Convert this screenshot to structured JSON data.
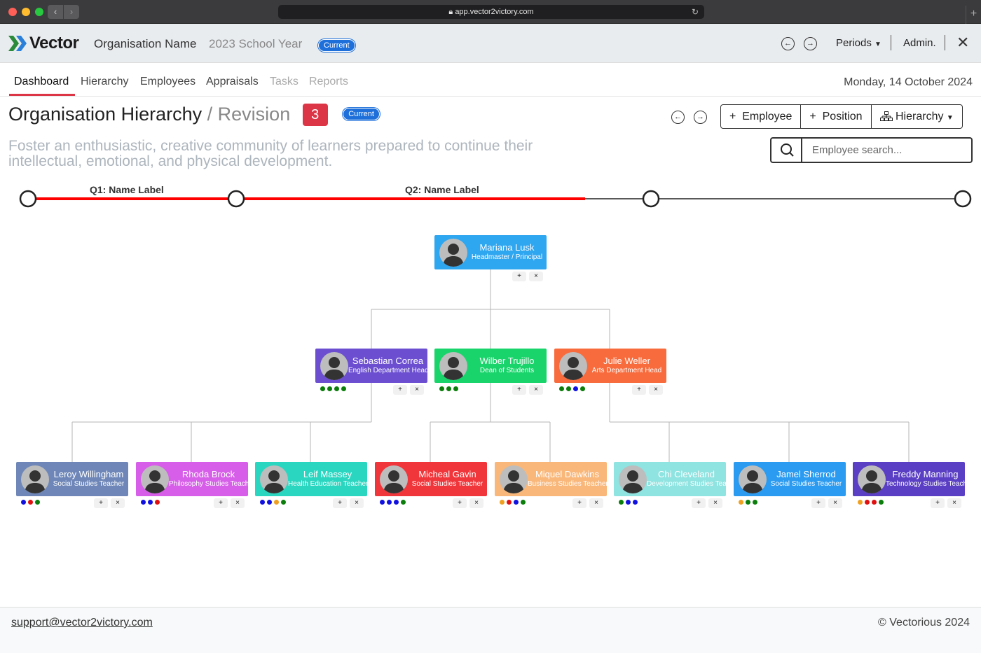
{
  "browser": {
    "url": "app.vector2victory.com",
    "back": "‹",
    "forward": "›"
  },
  "header": {
    "brand": "Vector",
    "org_name": "Organisation Name",
    "year": "2023 School Year",
    "year_badge": "Current",
    "periods_label": "Periods",
    "admin_label": "Admin."
  },
  "tabs": [
    {
      "label": "Dashboard",
      "state": "active"
    },
    {
      "label": "Hierarchy",
      "state": "normal"
    },
    {
      "label": "Employees",
      "state": "normal"
    },
    {
      "label": "Appraisals",
      "state": "normal"
    },
    {
      "label": "Tasks",
      "state": "disabled"
    },
    {
      "label": "Reports",
      "state": "disabled"
    }
  ],
  "date": "Monday, 14 October 2024",
  "page": {
    "title": "Organisation Hierarchy",
    "subtitle": "Revision",
    "revision": "3",
    "badge": "Current",
    "mission": "Foster an enthusiastic, creative community of learners prepared to continue their intellectual, emotional, and physical development."
  },
  "actions": {
    "employee": "Employee",
    "position": "Position",
    "hierarchy": "Hierarchy"
  },
  "search": {
    "placeholder": "Employee search..."
  },
  "timeline": {
    "labels": [
      "Q1: Name Label",
      "Q2: Name Label"
    ],
    "active_color": "#ff0000"
  },
  "orgchart": {
    "root": {
      "name": "Mariana Lusk",
      "role": "Headmaster / Principal",
      "color": "#2fa6f0",
      "dots": []
    },
    "level1": [
      {
        "name": "Sebastian Correa",
        "role": "English Department Head",
        "color": "#6c4fd1",
        "dots": [
          "#0a7d0a",
          "#0a7d0a",
          "#0a7d0a",
          "#0a7d0a"
        ]
      },
      {
        "name": "Wilber Trujillo",
        "role": "Dean of Students",
        "color": "#18d46a",
        "dots": [
          "#0a7d0a",
          "#0a7d0a",
          "#0a7d0a"
        ]
      },
      {
        "name": "Julie Weller",
        "role": "Arts Department Head",
        "color": "#f76b3c",
        "dots": [
          "#0a7d0a",
          "#0a7d0a",
          "#1010e0",
          "#0a7d0a"
        ]
      }
    ],
    "level2": [
      {
        "name": "Leroy Willingham",
        "role": "Social Studies Teacher",
        "color": "#6e87b8",
        "dots": [
          "#1010e0",
          "#e01010",
          "#0a7d0a"
        ]
      },
      {
        "name": "Rhoda Brock",
        "role": "Philosophy Studies Teacher",
        "color": "#d65ee8",
        "dots": [
          "#1010e0",
          "#1010e0",
          "#e01010"
        ]
      },
      {
        "name": "Leif Massey",
        "role": "Health Education Teacher",
        "color": "#2ad6c0",
        "dots": [
          "#1010e0",
          "#1010e0",
          "#f0a020",
          "#0a7d0a"
        ]
      },
      {
        "name": "Micheal Gavin",
        "role": "Social Studies Teacher",
        "color": "#f0363a",
        "dots": [
          "#1010e0",
          "#1010e0",
          "#1010e0",
          "#0a7d0a"
        ]
      },
      {
        "name": "Miquel Dawkins",
        "role": "Business Studies Teacher",
        "color": "#f9b77a",
        "dots": [
          "#f0a020",
          "#e01010",
          "#1010e0",
          "#0a7d0a"
        ]
      },
      {
        "name": "Chi Cleveland",
        "role": "Development Studies Teacher",
        "color": "#8fe3e0",
        "dots": [
          "#0a7d0a",
          "#1010e0",
          "#1010e0"
        ]
      },
      {
        "name": "Jamel Sherrod",
        "role": "Social Studies Teacher",
        "color": "#2a9bf0",
        "dots": [
          "#f0a020",
          "#0a7d0a",
          "#0a7d0a"
        ]
      },
      {
        "name": "Freddy Manning",
        "role": "Technology Studies Teacher",
        "color": "#5a3fc4",
        "dots": [
          "#f0a020",
          "#e01010",
          "#e01010",
          "#0a7d0a"
        ]
      }
    ]
  },
  "footer": {
    "email": "support@vector2victory.com",
    "copyright": "© Vectorious 2024"
  }
}
